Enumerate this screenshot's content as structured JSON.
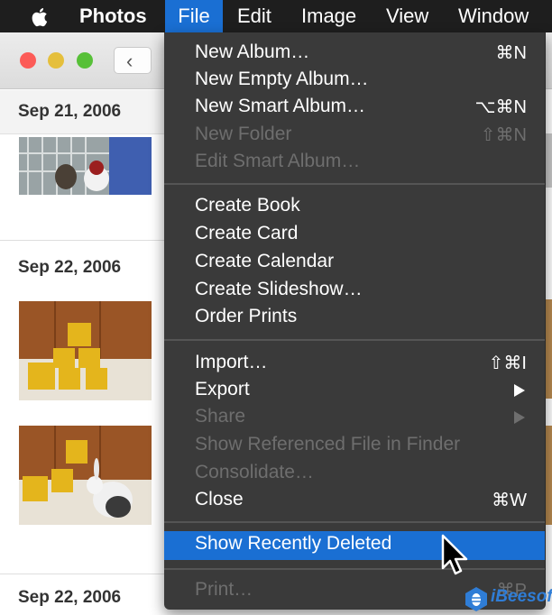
{
  "menubar": {
    "apple_icon": "apple-logo-icon",
    "app_name": "Photos",
    "items": [
      "File",
      "Edit",
      "Image",
      "View",
      "Window"
    ]
  },
  "window": {
    "back_button": "‹",
    "groups": [
      {
        "date": "Sep 21, 2006"
      },
      {
        "date": "Sep 22, 2006"
      },
      {
        "date": "Sep 22, 2006"
      }
    ]
  },
  "file_menu": {
    "items": [
      {
        "label": "New Album…",
        "shortcut": "⌘N",
        "enabled": true
      },
      {
        "label": "New Empty Album…",
        "shortcut": "",
        "enabled": true
      },
      {
        "label": "New Smart Album…",
        "shortcut": "⌥⌘N",
        "enabled": true
      },
      {
        "label": "New Folder",
        "shortcut": "⇧⌘N",
        "enabled": false
      },
      {
        "label": "Edit Smart Album…",
        "shortcut": "",
        "enabled": false
      },
      {
        "label": "Create Book",
        "shortcut": "",
        "enabled": true
      },
      {
        "label": "Create Card",
        "shortcut": "",
        "enabled": true
      },
      {
        "label": "Create Calendar",
        "shortcut": "",
        "enabled": true
      },
      {
        "label": "Create Slideshow…",
        "shortcut": "",
        "enabled": true
      },
      {
        "label": "Order Prints",
        "shortcut": "",
        "enabled": true
      },
      {
        "label": "Import…",
        "shortcut": "⇧⌘I",
        "enabled": true
      },
      {
        "label": "Export",
        "shortcut": "",
        "enabled": true,
        "submenu": true
      },
      {
        "label": "Share",
        "shortcut": "",
        "enabled": false,
        "submenu": true
      },
      {
        "label": "Show Referenced File in Finder",
        "shortcut": "",
        "enabled": false
      },
      {
        "label": "Consolidate…",
        "shortcut": "",
        "enabled": false
      },
      {
        "label": "Close",
        "shortcut": "⌘W",
        "enabled": true
      },
      {
        "label": "Show Recently Deleted",
        "shortcut": "",
        "enabled": true,
        "highlighted": true
      },
      {
        "label": "Print…",
        "shortcut": "⌘P",
        "enabled": false
      }
    ]
  },
  "colors": {
    "menubar_bg": "#1e1e1e",
    "menu_bg": "#3a3a3a",
    "highlight": "#1a6fd3",
    "disabled_text": "#6e6e6e"
  },
  "watermark": {
    "text": "iBeesoft"
  }
}
